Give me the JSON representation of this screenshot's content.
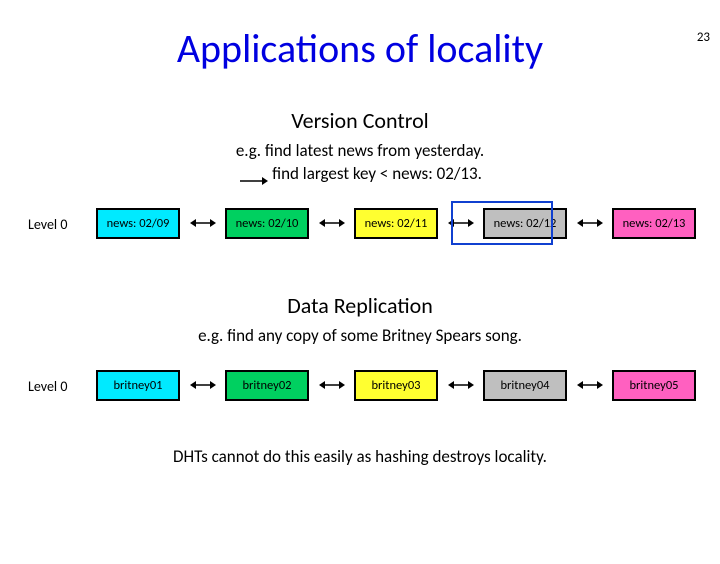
{
  "slide_number": "23",
  "title": "Applications of locality",
  "section1": {
    "heading": "Version Control",
    "line1": "e.g. find latest news from yesterday.",
    "line2": "find largest key < news: 02/13.",
    "level_label": "Level 0",
    "nodes": [
      "news: 02/09",
      "news: 02/10",
      "news: 02/11",
      "news: 02/12",
      "news: 02/13"
    ]
  },
  "section2": {
    "heading": "Data Replication",
    "line1": "e.g. find any copy of some Britney Spears song.",
    "level_label": "Level 0",
    "nodes": [
      "britney01",
      "britney02",
      "britney03",
      "britney04",
      "britney05"
    ]
  },
  "footer": "DHTs cannot do this easily as hashing destroys locality."
}
